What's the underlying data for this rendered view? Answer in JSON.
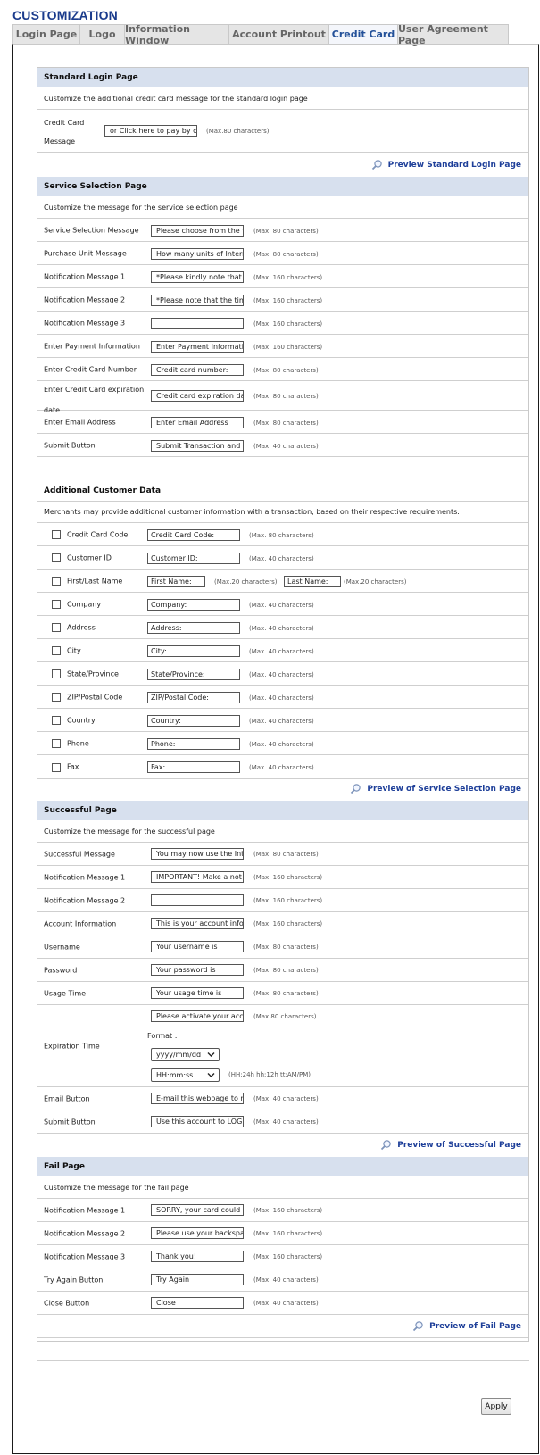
{
  "page_title": "CUSTOMIZATION",
  "tabs": [
    "Login Page",
    "Logo",
    "Information Window",
    "Account Printout",
    "Credit Card",
    "User Agreement Page"
  ],
  "active_tab": "Credit Card",
  "login": {
    "title": "Standard Login Page",
    "desc": "Customize the additional credit card message for the standard login page",
    "field_label_1": "Credit Card",
    "field_label_2": "Message",
    "value": "or Click here to pay by credit card",
    "hint": "(Max.80 characters)",
    "preview": "Preview Standard Login Page"
  },
  "service": {
    "title": "Service Selection Page",
    "desc": "Customize the message for the service selection page",
    "rows": [
      {
        "label": "Service Selection Message",
        "value": "Please choose from the f",
        "hint": "(Max. 80 characters)"
      },
      {
        "label": "Purchase Unit Message",
        "value": "How many units of Interr",
        "hint": "(Max. 80 characters)"
      },
      {
        "label": "Notification Message 1",
        "value": "*Please kindly note that t",
        "hint": "(Max. 160 characters)"
      },
      {
        "label": "Notification Message 2",
        "value": "*Please note that the tim",
        "hint": "(Max. 160 characters)"
      },
      {
        "label": "Notification Message 3",
        "value": "",
        "hint": "(Max. 160 characters)"
      },
      {
        "label": "Enter Payment Information",
        "value": "Enter Payment Informatic",
        "hint": "(Max. 160 characters)"
      },
      {
        "label": "Enter Credit Card Number",
        "value": "Credit card number:",
        "hint": "(Max. 80 characters)"
      },
      {
        "label": "Enter Credit Card expiration",
        "label2": "date",
        "value": "Credit card expiration dat",
        "hint": "(Max. 80 characters)"
      },
      {
        "label": "Enter Email Address",
        "value": "Enter Email Address",
        "hint": "(Max. 80 characters)"
      },
      {
        "label": "Submit Button",
        "value": "Submit Transaction and l",
        "hint": "(Max. 40 characters)"
      }
    ],
    "preview": "Preview of Service Selection Page"
  },
  "additional": {
    "title": "Additional Customer Data",
    "desc": "Merchants may provide additional customer information with a transaction, based on their respective requirements.",
    "rows": [
      {
        "label": "Credit Card Code",
        "value": "Credit Card Code:",
        "hint": "(Max. 80 characters)"
      },
      {
        "label": "Customer ID",
        "value": "Customer ID:",
        "hint": "(Max. 40 characters)"
      },
      {
        "label": "First/Last Name",
        "value": "First Name:",
        "hint": "(Max.20 characters)",
        "value2": "Last Name:",
        "hint2": "(Max.20 characters)"
      },
      {
        "label": "Company",
        "value": "Company:",
        "hint": "(Max. 40 characters)"
      },
      {
        "label": "Address",
        "value": "Address:",
        "hint": "(Max. 40 characters)"
      },
      {
        "label": "City",
        "value": "City:",
        "hint": "(Max. 40 characters)"
      },
      {
        "label": "State/Province",
        "value": "State/Province:",
        "hint": "(Max. 40 characters)"
      },
      {
        "label": "ZIP/Postal Code",
        "value": "ZIP/Postal Code:",
        "hint": "(Max. 40 characters)"
      },
      {
        "label": "Country",
        "value": "Country:",
        "hint": "(Max. 40 characters)"
      },
      {
        "label": "Phone",
        "value": "Phone:",
        "hint": "(Max. 40 characters)"
      },
      {
        "label": "Fax",
        "value": "Fax:",
        "hint": "(Max. 40 characters)"
      }
    ]
  },
  "success": {
    "title": "Successful Page",
    "desc": "Customize the message for the successful page",
    "rows": [
      {
        "label": "Successful Message",
        "value": "You may now use the Int",
        "hint": "(Max. 80 characters)"
      },
      {
        "label": "Notification Message 1",
        "value": "IMPORTANT! Make a not",
        "hint": "(Max. 160 characters)"
      },
      {
        "label": "Notification Message 2",
        "value": "",
        "hint": "(Max. 160 characters)"
      },
      {
        "label": "Account Information",
        "value": "This is your account infor",
        "hint": "(Max. 160 characters)"
      },
      {
        "label": "Username",
        "value": "Your username is",
        "hint": "(Max. 80 characters)"
      },
      {
        "label": "Password",
        "value": "Your password is",
        "hint": "(Max. 80 characters)"
      },
      {
        "label": "Usage Time",
        "value": "Your usage time is",
        "hint": "(Max. 80 characters)"
      }
    ],
    "expiration": {
      "label": "Expiration Time",
      "value": "Please activate your acco",
      "hint": "(Max.80 characters)",
      "format_label": "Format :",
      "date_format": "yyyy/mm/dd",
      "time_format": "HH:mm:ss",
      "time_hint": "(HH:24h hh:12h tt:AM/PM)"
    },
    "rows2": [
      {
        "label": "Email Button",
        "value": "E-mail this webpage to m",
        "hint": "(Max. 40 characters)"
      },
      {
        "label": "Submit Button",
        "value": "Use this account to LOGI",
        "hint": "(Max. 40 characters)"
      }
    ],
    "preview": "Preview of Successful Page"
  },
  "fail": {
    "title": "Fail Page",
    "desc": "Customize the message for the fail page",
    "rows": [
      {
        "label": "Notification Message 1",
        "value": "SORRY, your card could n",
        "hint": "(Max. 160 characters)"
      },
      {
        "label": "Notification Message 2",
        "value": "Please use your backspac",
        "hint": "(Max. 160 characters)"
      },
      {
        "label": "Notification Message 3",
        "value": "Thank you!",
        "hint": "(Max. 160 characters)"
      },
      {
        "label": "Try Again Button",
        "value": "Try Again",
        "hint": "(Max. 40 characters)"
      },
      {
        "label": "Close Button",
        "value": "Close",
        "hint": "(Max. 40 characters)"
      }
    ],
    "preview": "Preview of Fail Page"
  },
  "apply_label": "Apply",
  "icons": {
    "preview": "magnifier-icon",
    "dropdown": "chevron-down-icon"
  },
  "colors": {
    "title": "#1a3b8c",
    "header_bg": "#d7e0ee",
    "link": "#1e3f99"
  }
}
